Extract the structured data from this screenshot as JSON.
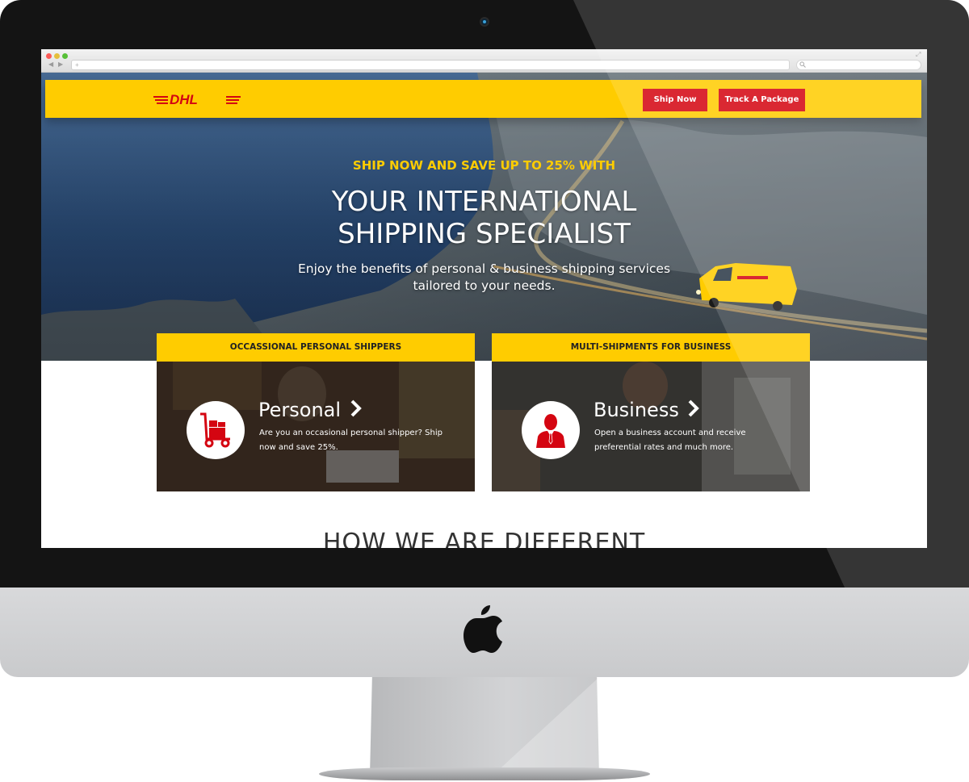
{
  "browser": {
    "address_placeholder": "+"
  },
  "header": {
    "logo_text": "DHL",
    "ship_now_label": "Ship Now",
    "track_label": "Track A Package"
  },
  "hero": {
    "eyebrow": "SHIP NOW AND SAVE UP TO 25% WITH",
    "title_line1": "YOUR INTERNATIONAL",
    "title_line2": "SHIPPING SPECIALIST",
    "subtitle": "Enjoy the benefits of personal & business shipping services tailored to your needs."
  },
  "cards": [
    {
      "tab": "OCCASSIONAL PERSONAL SHIPPERS",
      "heading": "Personal",
      "text": "Are you an occasional personal shipper? Ship now and save 25%.",
      "icon": "hand-truck-icon"
    },
    {
      "tab": "MULTI-SHIPMENTS FOR BUSINESS",
      "heading": "Business",
      "text": "Open a business account and receive preferential rates and much more.",
      "icon": "businessman-icon"
    }
  ],
  "section": {
    "heading": "HOW WE ARE DIFFERENT"
  },
  "colors": {
    "brand_yellow": "#ffcc00",
    "brand_red": "#d40511"
  }
}
